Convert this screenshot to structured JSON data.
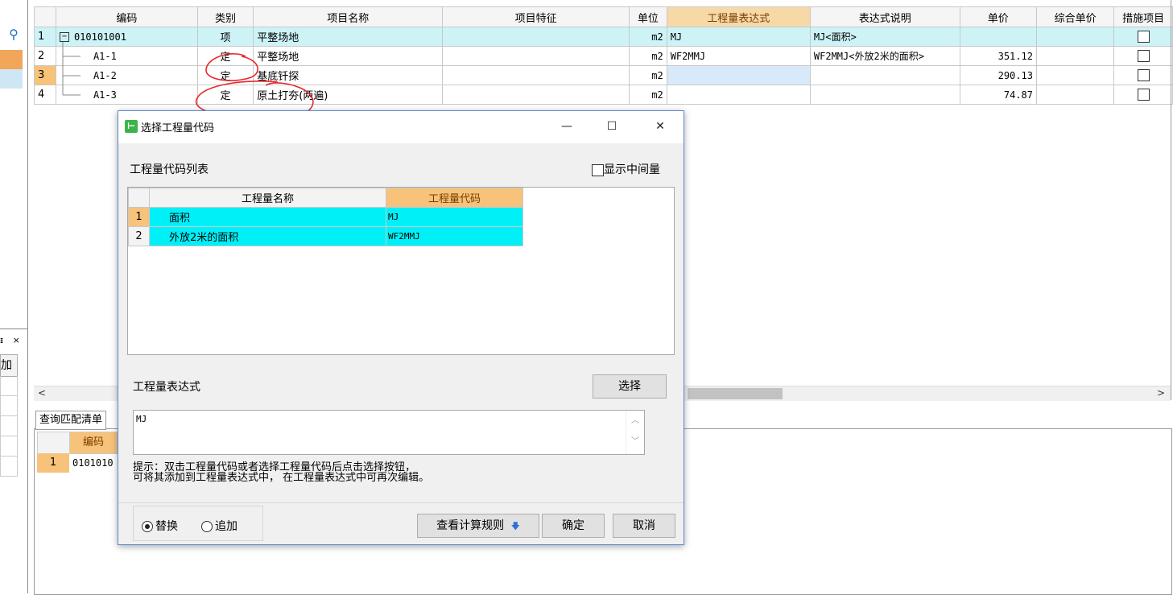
{
  "grid": {
    "headers": [
      "编码",
      "类别",
      "项目名称",
      "项目特征",
      "单位",
      "工程量表达式",
      "表达式说明",
      "单价",
      "综合单价",
      "措施项目"
    ],
    "rows": [
      {
        "num": "1",
        "code": "010101001",
        "type": "项",
        "name": "平整场地",
        "feature": "",
        "unit": "m2",
        "expr": "MJ",
        "desc": "MJ<面积>",
        "price": "",
        "total": ""
      },
      {
        "num": "2",
        "code": "A1-1",
        "type": "定",
        "name": "平整场地",
        "feature": "",
        "unit": "m2",
        "expr": "WF2MMJ",
        "desc": "WF2MMJ<外放2米的面积>",
        "price": "351.12",
        "total": ""
      },
      {
        "num": "3",
        "code": "A1-2",
        "type": "定",
        "name": "基底钎探",
        "feature": "",
        "unit": "m2",
        "expr": "",
        "desc": "",
        "price": "290.13",
        "total": ""
      },
      {
        "num": "4",
        "code": "A1-3",
        "type": "定",
        "name": "原土打夯(两遍)",
        "feature": "",
        "unit": "m2",
        "expr": "",
        "desc": "",
        "price": "74.87",
        "total": ""
      }
    ]
  },
  "left": {
    "mini_tab_close": "×",
    "mini_header": "加",
    "mini_tab_pin": "ᵻ"
  },
  "lower": {
    "tab_label": "查询匹配清单",
    "header_code": "编码",
    "row_num": "1",
    "row_code": "0101010"
  },
  "dialog": {
    "title": "选择工程量代码",
    "section_list": "工程量代码列表",
    "show_intermediate": "显示中间量",
    "codes_headers": [
      "工程量名称",
      "工程量代码"
    ],
    "codes": [
      {
        "num": "1",
        "name": "面积",
        "code": "MJ"
      },
      {
        "num": "2",
        "name": "外放2米的面积",
        "code": "WF2MMJ"
      }
    ],
    "expr_label": "工程量表达式",
    "select_button": "选择",
    "expr_value": "MJ",
    "hint_line1": "提示：双击工程量代码或者选择工程量代码后点击选择按钮，",
    "hint_line2": "可将其添加到工程量表达式中， 在工程量表达式中可再次编辑。",
    "radio_replace": "替换",
    "radio_append": "追加",
    "rules_button": "查看计算规则",
    "ok_button": "确定",
    "cancel_button": "取消"
  },
  "colors": {
    "accent_orange": "#f7c27a",
    "selection_cyan": "#00f0f8",
    "row_highlight": "#cdf3f7",
    "annotation_red": "#e8262a"
  }
}
